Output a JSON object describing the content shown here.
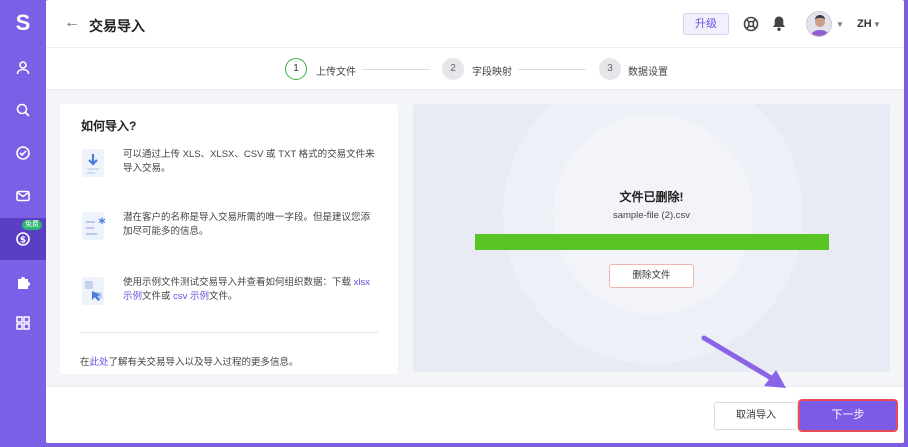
{
  "sidebar": {
    "logo": "S",
    "badge": "免费"
  },
  "header": {
    "back_symbol": "←",
    "title": "交易导入",
    "upgrade_label": "升级",
    "language": "ZH"
  },
  "steps": [
    {
      "number": "1",
      "label": "上传文件"
    },
    {
      "number": "2",
      "label": "字段映射"
    },
    {
      "number": "3",
      "label": "数据设置"
    }
  ],
  "help": {
    "title": "如何导入?",
    "item1": "可以通过上传 XLS、XLSX、CSV 或 TXT 格式的交易文件来导入交易。",
    "item2": "潜在客户的名称是导入交易所需的唯一字段。但是建议您添加尽可能多的信息。",
    "item3_prefix": "使用示例文件测试交易导入并查看如何组织数据：下载 ",
    "item3_xlsx_link": "xlsx 示例",
    "item3_middle": "文件或 ",
    "item3_csv_link": "csv 示例",
    "item3_suffix": "文件。",
    "footer_prefix": "在",
    "footer_link": "此处",
    "footer_suffix": "了解有关交易导入以及导入过程的更多信息。"
  },
  "upload": {
    "status_title": "文件已删除!",
    "file_name": "sample-file (2).csv",
    "progress": 1.0,
    "delete_label": "删除文件"
  },
  "footer": {
    "cancel_label": "取消导入",
    "next_label": "下一步"
  },
  "colors": {
    "accent": "#7b5fe6",
    "success": "#58c324",
    "highlight": "#e84a5a"
  }
}
